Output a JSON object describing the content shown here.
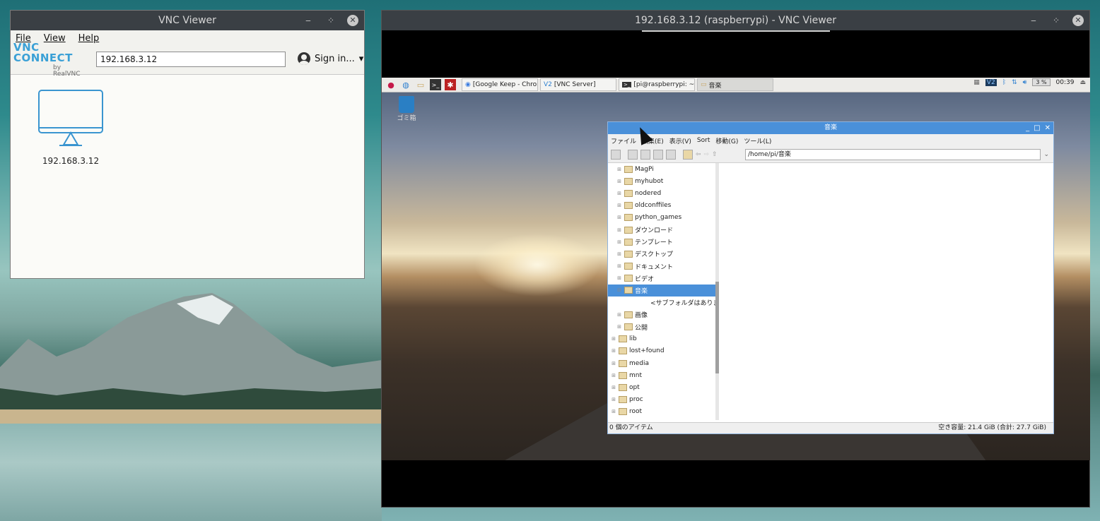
{
  "local_viewer": {
    "title": "VNC Viewer",
    "menu": [
      "File",
      "View",
      "Help"
    ],
    "logo_main": "VNC CONNECT",
    "logo_sub": "by RealVNC",
    "address_value": "192.168.3.12",
    "sign_in_label": "Sign in...",
    "computer_label": "192.168.3.12",
    "window_controls": [
      "minimize-icon",
      "restore-icon",
      "close-icon"
    ]
  },
  "remote_viewer": {
    "title": "192.168.3.12 (raspberrypi) - VNC Viewer",
    "taskbar": {
      "tasks": [
        "[Google Keep - Chrom...",
        "[VNC Server]",
        "[pi@raspberrypi: ~]",
        "音楽"
      ],
      "cpu": "3 %",
      "clock": "00:39"
    },
    "trash_label": "ゴミ箱",
    "file_manager": {
      "title": "音楽",
      "menu": [
        "ファイル",
        "編集(E)",
        "表示(V)",
        "Sort",
        "移動(G)",
        "ツール(L)"
      ],
      "path": "/home/pi/音楽",
      "tree": [
        {
          "label": "MagPi",
          "indent": 2
        },
        {
          "label": "myhubot",
          "indent": 2
        },
        {
          "label": "nodered",
          "indent": 2
        },
        {
          "label": "oldconffiles",
          "indent": 2
        },
        {
          "label": "python_games",
          "indent": 2
        },
        {
          "label": "ダウンロード",
          "indent": 2
        },
        {
          "label": "テンプレート",
          "indent": 2
        },
        {
          "label": "デスクトップ",
          "indent": 2
        },
        {
          "label": "ドキュメント",
          "indent": 2
        },
        {
          "label": "ビデオ",
          "indent": 2
        },
        {
          "label": "音楽",
          "indent": 2,
          "selected": true
        },
        {
          "label": "<サブフォルダはありま",
          "indent": 3,
          "nofolder": true
        },
        {
          "label": "画像",
          "indent": 2
        },
        {
          "label": "公開",
          "indent": 2
        },
        {
          "label": "lib",
          "indent": 1
        },
        {
          "label": "lost+found",
          "indent": 1
        },
        {
          "label": "media",
          "indent": 1
        },
        {
          "label": "mnt",
          "indent": 1
        },
        {
          "label": "opt",
          "indent": 1
        },
        {
          "label": "proc",
          "indent": 1
        },
        {
          "label": "root",
          "indent": 1
        }
      ],
      "status_left": "0 個のアイテム",
      "status_right": "空き容量: 21.4 GiB (合計: 27.7 GiB)"
    }
  }
}
